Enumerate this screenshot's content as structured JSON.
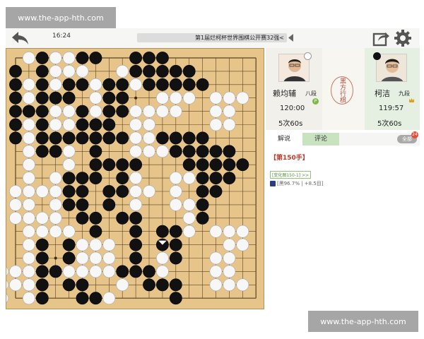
{
  "watermark": {
    "top": "www.the-app-hth.com",
    "bottom": "www.the-app-hth.com"
  },
  "topbar": {
    "time": "16:24",
    "title": "第1届烂柯杯世界围棋公开赛32强<"
  },
  "colors": {
    "board": "#e6c48a",
    "accent_green": "#c9e3c1",
    "alert_red": "#e04e3c"
  },
  "board": {
    "size": 19,
    "last_move": "M15",
    "black": [
      "C1",
      "F1",
      "G1",
      "C2",
      "C3",
      "E3",
      "F3",
      "H3",
      "J3",
      "A4",
      "C4",
      "D4",
      "E4",
      "H4",
      "J4",
      "A5",
      "B5",
      "C5",
      "F5",
      "H5",
      "J5",
      "A6",
      "C6",
      "F6",
      "G6",
      "H6",
      "C7",
      "D7",
      "E7",
      "F7",
      "G7",
      "H7",
      "J7",
      "C8",
      "D8",
      "G8",
      "G9",
      "H9",
      "J9",
      "K9",
      "E10",
      "F10",
      "G10",
      "J10",
      "E11",
      "F11",
      "H11",
      "J11",
      "E12",
      "F12",
      "H12",
      "F13",
      "G13",
      "J13",
      "K13",
      "G14",
      "K14",
      "M14",
      "N14",
      "C15",
      "E15",
      "K15",
      "M15",
      "N15",
      "C16",
      "E16",
      "K16",
      "N16",
      "C17",
      "D17",
      "J17",
      "K17",
      "L17",
      "C18",
      "E18",
      "F18",
      "L18",
      "M18",
      "N18",
      "C19",
      "F19",
      "G19",
      "N19",
      "K1",
      "L1",
      "M1",
      "A2",
      "K2",
      "L2",
      "M2",
      "N2",
      "O2",
      "A3",
      "L3",
      "M3",
      "N3",
      "O3",
      "P3",
      "A7",
      "M7",
      "N7",
      "O7",
      "P7",
      "N8",
      "O8",
      "P8",
      "Q8",
      "R8",
      "O9",
      "P9",
      "Q9",
      "R9",
      "S9",
      "P10",
      "Q10",
      "R10",
      "P11",
      "Q11",
      "P12",
      "P13"
    ],
    "white": [
      "B1",
      "D1",
      "E1",
      "D2",
      "E2",
      "F2",
      "B3",
      "D3",
      "G3",
      "B4",
      "G4",
      "B5",
      "D5",
      "E5",
      "G5",
      "B6",
      "D6",
      "E6",
      "B7",
      "B8",
      "E8",
      "B9",
      "E9",
      "B10",
      "D10",
      "A11",
      "B11",
      "C11",
      "D11",
      "A12",
      "B12",
      "D12",
      "A13",
      "B13",
      "C13",
      "D13",
      "B14",
      "C14",
      "D14",
      "E14",
      "B15",
      "F15",
      "G15",
      "H15",
      "B16",
      "F16",
      "G16",
      "H16",
      "A17",
      "B17",
      "E17",
      "F17",
      "G17",
      "H17",
      "I17",
      "A18",
      "B18",
      "I18",
      "J18",
      "B19",
      "H19",
      "I19",
      "K3",
      "J2",
      "M4",
      "N4",
      "O4",
      "K5",
      "L5",
      "M5",
      "N5",
      "K6",
      "L6",
      "Q6",
      "R6",
      "K7",
      "L7",
      "K8",
      "L8",
      "M8",
      "Q5",
      "R5",
      "Q4",
      "R4",
      "S4",
      "O12",
      "O13",
      "O14",
      "Q14",
      "R14",
      "S14",
      "R15",
      "S15",
      "Q16",
      "R16",
      "Q17",
      "R17",
      "Q18",
      "R18",
      "S18",
      "M17",
      "M16",
      "L11",
      "K10",
      "K11",
      "K12",
      "N10",
      "O10",
      "N11",
      "N12"
    ]
  },
  "players": {
    "left": {
      "name": "赖均辅",
      "rank": "八段",
      "time": "120:00",
      "byoyomi": "5次60s",
      "stone": "white",
      "badge": "P"
    },
    "right": {
      "name": "柯洁",
      "rank": "九段",
      "time": "119:57",
      "byoyomi": "5次60s",
      "stone": "black"
    },
    "turn_seal": "黑方行棋"
  },
  "tabs": {
    "explain": "解说",
    "comments": "评论",
    "all": "全部",
    "count": "24"
  },
  "comment": {
    "move": "【第150手】",
    "variation": "[变化图150-1] >>",
    "eval": "[黑96.7% | +8.5目]"
  }
}
